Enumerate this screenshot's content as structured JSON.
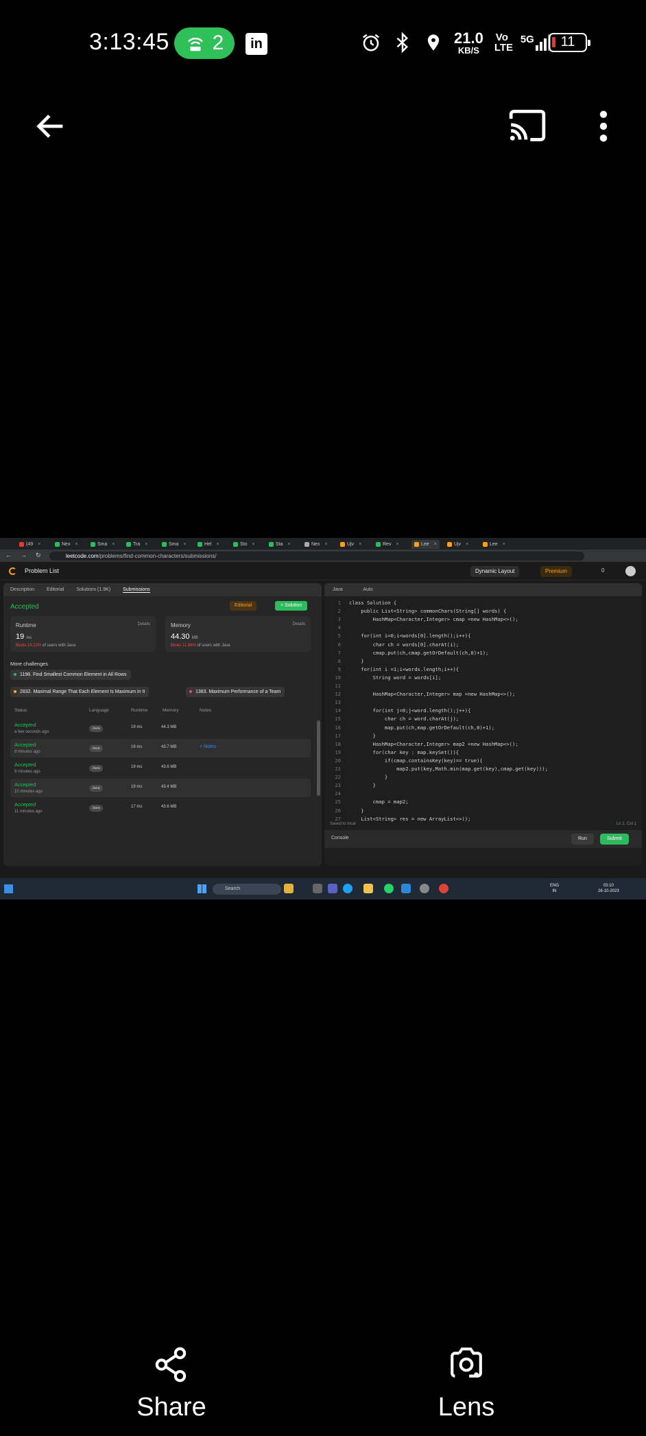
{
  "status_bar": {
    "time": "3:13:45",
    "hotspot_count": "2",
    "net_speed_value": "21.0",
    "net_speed_unit": "KB/S",
    "volte_label": "Vo LTE",
    "network_label": "5G",
    "battery_level": "11"
  },
  "viewer_toolbar": {
    "back_icon": "back-arrow-icon",
    "cast_icon": "cast-icon",
    "more_icon": "more-vert-icon"
  },
  "screenshot": {
    "browser": {
      "tabs": [
        "(49",
        "Nex",
        "Sma",
        "Tra",
        "Sma",
        "Hel",
        "Sto",
        "Sta",
        "Nex",
        "Ujv",
        "Rev",
        "Lee",
        "Ujv",
        "Lee"
      ],
      "url_host": "leetcode.com",
      "url_path": "/problems/find-common-characters/submissions/"
    },
    "leetcode_header": {
      "problem_list": "Problem List",
      "dynamic_layout": "Dynamic Layout",
      "premium": "Premium",
      "streak": "0"
    },
    "left_tabs": [
      "Description",
      "Editorial",
      "Solutions (1.9K)",
      "Submissions"
    ],
    "result": {
      "status": "Accepted",
      "editorial_label": "Editorial",
      "solution_label": "+ Solution",
      "runtime": {
        "title": "Runtime",
        "details": "Details",
        "value": "19",
        "unit": "ms",
        "beats": "Beats 19.22%",
        "beats_suffix": "of users with Java"
      },
      "memory": {
        "title": "Memory",
        "details": "Details",
        "value": "44.30",
        "unit": "MB",
        "beats": "Beats 11.88%",
        "beats_suffix": "of users with Java"
      }
    },
    "more_challenges": {
      "title": "More challenges",
      "items": [
        "1198. Find Smallest Common Element in All Rows",
        "2832. Maximal Range That Each Element Is Maximum in It",
        "1383. Maximum Performance of a Team"
      ]
    },
    "submissions": {
      "headers": [
        "Status",
        "Language",
        "Runtime",
        "Memory",
        "Notes"
      ],
      "rows": [
        {
          "status": "Accepted",
          "time": "a few seconds ago",
          "lang": "Java",
          "runtime": "19 ms",
          "memory": "44.3 MB",
          "notes": ""
        },
        {
          "status": "Accepted",
          "time": "8 minutes ago",
          "lang": "Java",
          "runtime": "19 ms",
          "memory": "43.7 MB",
          "notes": "+ Notes"
        },
        {
          "status": "Accepted",
          "time": "9 minutes ago",
          "lang": "Java",
          "runtime": "19 ms",
          "memory": "43.6 MB",
          "notes": ""
        },
        {
          "status": "Accepted",
          "time": "10 minutes ago",
          "lang": "Java",
          "runtime": "19 ms",
          "memory": "43.4 MB",
          "notes": ""
        },
        {
          "status": "Accepted",
          "time": "11 minutes ago",
          "lang": "Java",
          "runtime": "17 ms",
          "memory": "43.6 MB",
          "notes": ""
        }
      ]
    },
    "editor": {
      "language": "Java",
      "mode": "Auto",
      "lines": [
        "class Solution {",
        "    public List<String> commonChars(String[] words) {",
        "        HashMap<Character,Integer> cmap =new HashMap<>();",
        "",
        "    for(int i=0;i<words[0].length();i++){",
        "        char ch = words[0].charAt(i);",
        "        cmap.put(ch,cmap.getOrDefault(ch,0)+1);",
        "    }",
        "    for(int i =1;i<words.length;i++){",
        "        String word = words[i];",
        "",
        "        HashMap<Character,Integer> map =new HashMap<>();",
        "",
        "        for(int j=0;j<word.length();j++){",
        "            char ch = word.charAt(j);",
        "            map.put(ch,map.getOrDefault(ch,0)+1);",
        "        }",
        "        HashMap<Character,Integer> map2 =new HashMap<>();",
        "        for(char key : map.keySet()){",
        "            if(cmap.containsKey(key)== true){",
        "                map2.put(key,Math.min(map.get(key),cmap.get(key)));",
        "            }",
        "        }",
        "",
        "        cmap = map2;",
        "    }",
        "    List<String> res = new ArrayList<>();"
      ],
      "saved": "Saved to local",
      "cursor": "Ln 1, Col 1",
      "console_label": "Console",
      "run_label": "Run",
      "submit_label": "Submit"
    },
    "taskbar": {
      "search": "Search",
      "lang": "ENG",
      "region": "IN",
      "time": "03:10",
      "date": "26-10-2023"
    }
  },
  "actions": {
    "share": "Share",
    "lens": "Lens"
  },
  "colors": {
    "accepted": "#2cbb5d",
    "leetcode_orange": "#ffa116",
    "hotspot_green": "#2fc05a"
  }
}
